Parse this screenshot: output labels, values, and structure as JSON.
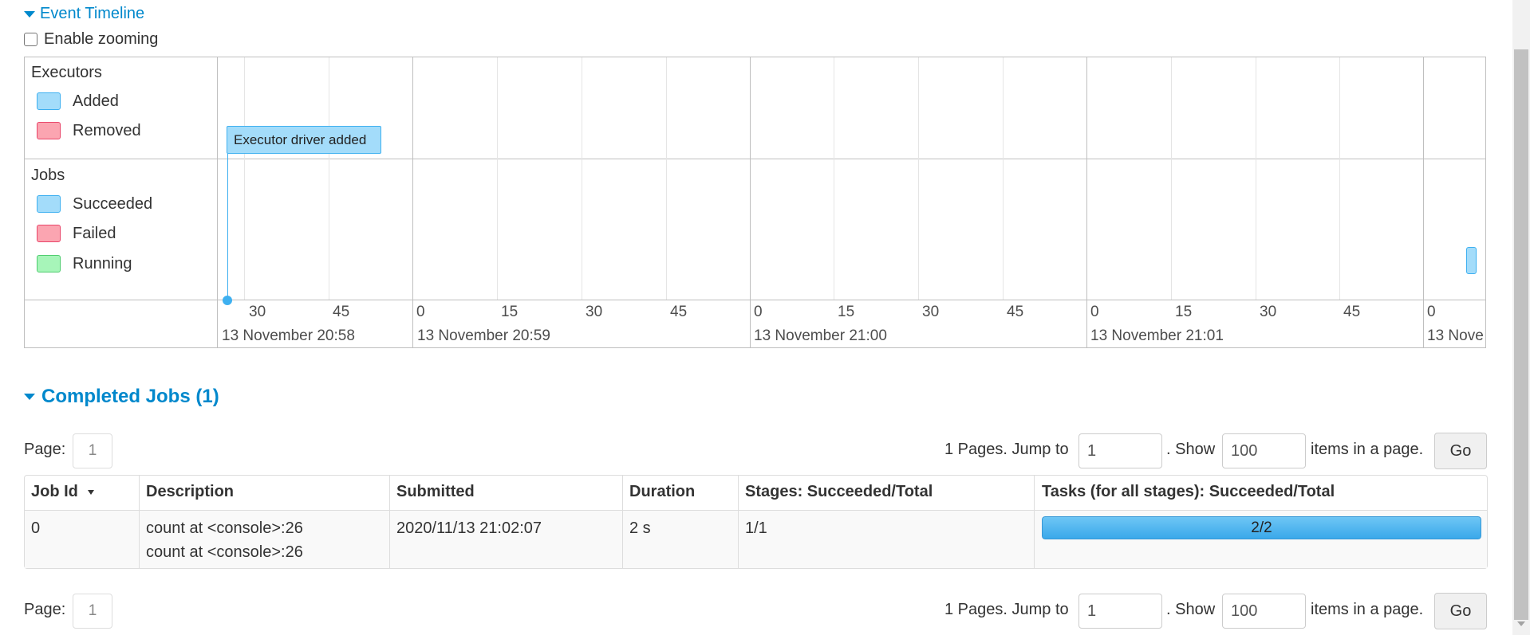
{
  "timeline": {
    "toggle_label": "Event Timeline",
    "zoom_label": "Enable zooming",
    "zoom_checked": false,
    "executors_group": "Executors",
    "executor_legend": [
      {
        "label": "Added",
        "color": "#a3dcfa"
      },
      {
        "label": "Removed",
        "color": "#fba5b1"
      }
    ],
    "jobs_group": "Jobs",
    "job_legend": [
      {
        "label": "Succeeded",
        "color": "#a3dcfa"
      },
      {
        "label": "Failed",
        "color": "#fba5b1"
      },
      {
        "label": "Running",
        "color": "#a7f5b9"
      }
    ],
    "event_label": "Executor driver added",
    "minor_ticks": [
      "30",
      "45",
      "0",
      "15",
      "30",
      "45",
      "0",
      "15",
      "30",
      "45",
      "0",
      "15",
      "30",
      "45",
      "0"
    ],
    "major_ticks": [
      "13 November 20:58",
      "13 November 20:59",
      "13 November 21:00",
      "13 November 21:01",
      "13 Nove"
    ]
  },
  "completed_jobs": {
    "title": "Completed Jobs (1)"
  },
  "pagination": {
    "page_label": "Page:",
    "current_page": "1",
    "pages_text": "1 Pages. Jump to",
    "jump_value": "1",
    "show_text": ". Show",
    "show_value": "100",
    "items_text": "items in a page.",
    "go_label": "Go"
  },
  "table": {
    "headers": [
      "Job Id",
      "Description",
      "Submitted",
      "Duration",
      "Stages: Succeeded/Total",
      "Tasks (for all stages): Succeeded/Total"
    ],
    "rows": [
      {
        "job_id": "0",
        "description": "count at <console>:26",
        "description_link": "count at <console>:26",
        "submitted": "2020/11/13 21:02:07",
        "duration": "2 s",
        "stages": "1/1",
        "tasks_text": "2/2",
        "tasks_progress": 1.0
      }
    ]
  }
}
